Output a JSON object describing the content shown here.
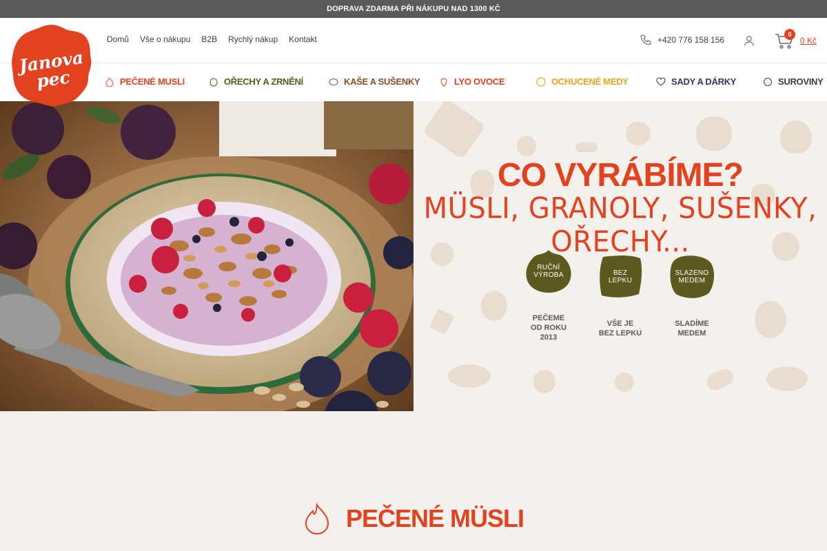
{
  "announcement": "DOPRAVA ZDARMA PŘI NÁKUPU NAD 1300 KČ",
  "logo": {
    "text_line1": "Janova",
    "text_line2": "pec"
  },
  "utility_nav": [
    "Domů",
    "Vše o nákupu",
    "B2B",
    "Rychlý nákup",
    "Kontakt"
  ],
  "contact": {
    "phone": "+420 776 158 156"
  },
  "cart": {
    "count": "0",
    "total": "0 Kč"
  },
  "categories": [
    {
      "label": "PEČENÉ MUSLI",
      "color": "#e2421f"
    },
    {
      "label": "OŘECHY A ZRNĚNÍ",
      "color": "#5c5a1f"
    },
    {
      "label": "KAŠE A SUŠENKY",
      "color": "#8a4b2a"
    },
    {
      "label": "LYO OVOCE",
      "color": "#e2421f"
    },
    {
      "label": "OCHUCENÉ MEDY",
      "color": "#e9a21a"
    },
    {
      "label": "SADY A DÁRKY",
      "color": "#3d2f66"
    },
    {
      "label": "SUROVINY",
      "color": "#3e3e3e"
    }
  ],
  "hero": {
    "title": "CO VYRÁBÍME?",
    "subtitle": "MÜSLI, GRANOLY, SUŠENKY, OŘECHY...",
    "badges": [
      {
        "icon_text": "RUČNÍ VÝROBA",
        "label_lines": [
          "PEČEME",
          "OD ROKU",
          "2013"
        ]
      },
      {
        "icon_text": "BEZ LEPKU",
        "label_lines": [
          "VŠE JE",
          "BEZ LEPKU"
        ]
      },
      {
        "icon_text": "SLAZENO MEDEM",
        "label_lines": [
          "SLADÍME",
          "MEDEM"
        ]
      }
    ]
  },
  "section": {
    "title": "PEČENÉ MÜSLI"
  },
  "colors": {
    "brand_red": "#e2421f",
    "badge_olive": "#5c5a1f",
    "bg": "#f4f1ec",
    "topbar": "#5a5a5a"
  }
}
